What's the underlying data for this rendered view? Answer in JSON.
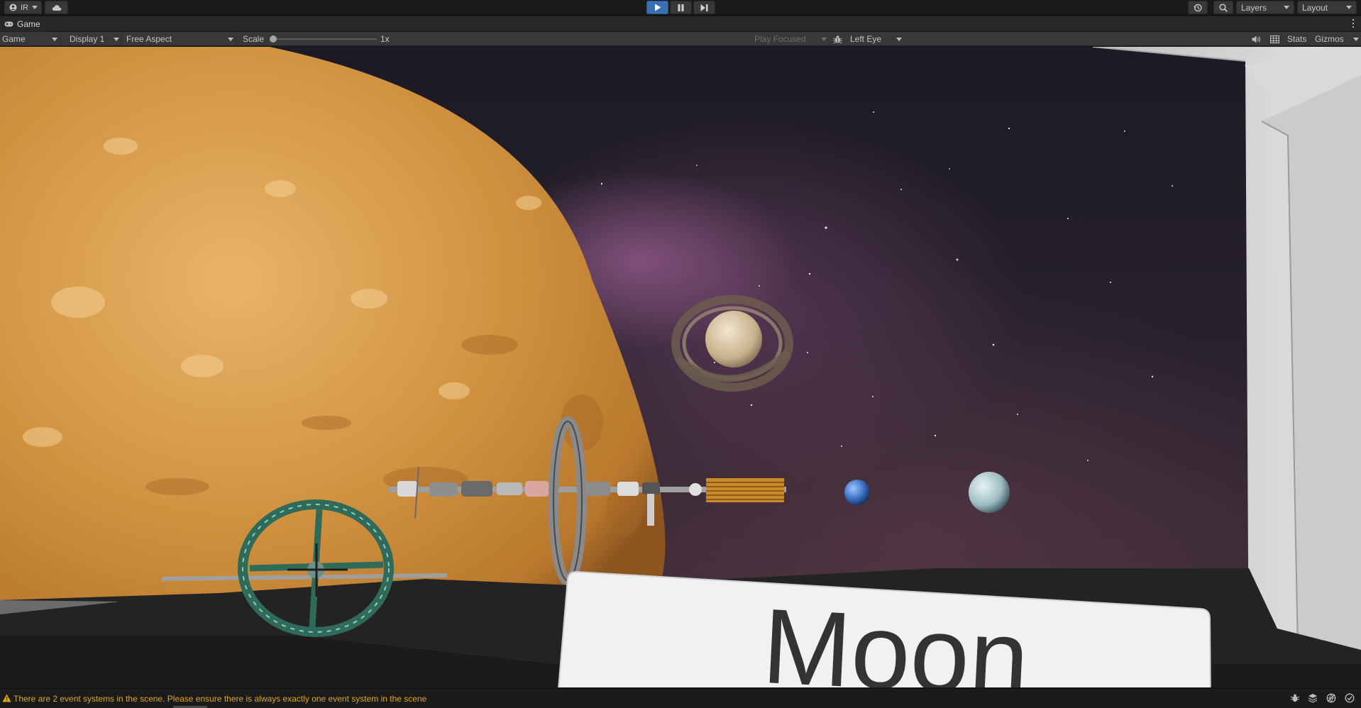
{
  "toolbar": {
    "account_label": "IR",
    "layers_label": "Layers",
    "layout_label": "Layout",
    "icons": [
      "account-icon",
      "cloud-icon",
      "play-icon",
      "pause-icon",
      "step-icon",
      "history-icon",
      "search-icon"
    ]
  },
  "tab": {
    "label": "Game",
    "icon": "gamepad-icon"
  },
  "controls": {
    "mode": "Game",
    "display": "Display 1",
    "aspect": "Free Aspect",
    "scale_label": "Scale",
    "scale_value": "1x",
    "scale_fraction": 0.0,
    "play_focused": "Play Focused",
    "eye": "Left Eye",
    "stats": "Stats",
    "gizmos": "Gizmos"
  },
  "scene": {
    "sign_text": "Moon"
  },
  "status": {
    "message": "There are 2 event systems in the scene. Please ensure there is always exactly one event system in the scene",
    "icon": "warning-icon"
  },
  "colors": {
    "play_active": "#3a6fb3",
    "warning": "#d9a52a",
    "planet": "#d59a48"
  }
}
